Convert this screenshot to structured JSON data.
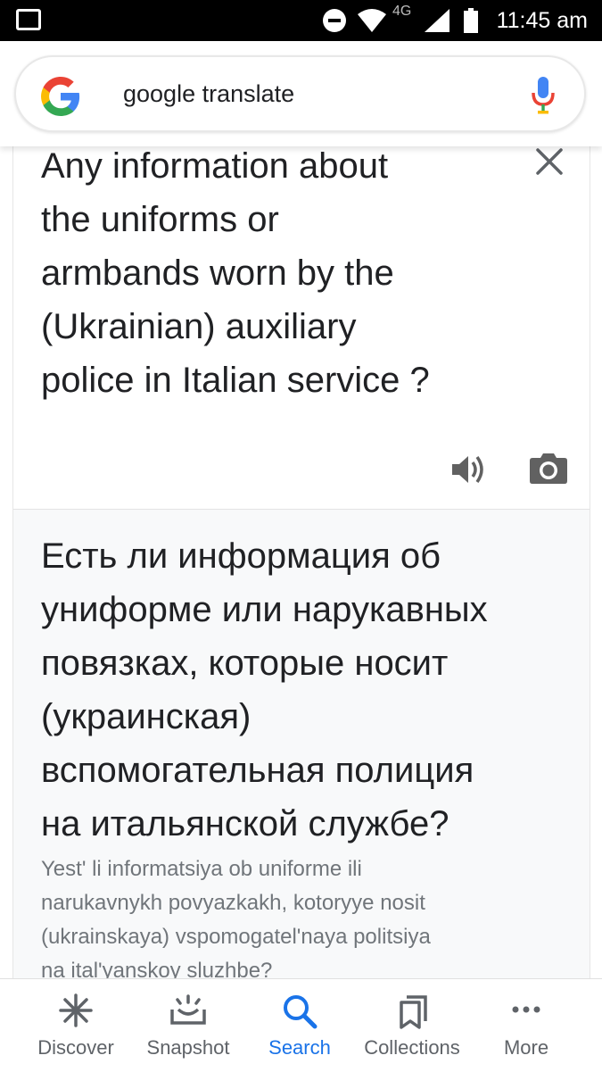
{
  "status_bar": {
    "time": "11:45 am",
    "network": "4G"
  },
  "search": {
    "query": "google translate",
    "logo_icon": "google-g-icon",
    "mic_icon": "mic-icon"
  },
  "translate": {
    "source_text": "Any information about\nthe uniforms or\narmbands worn by the\n(Ukrainian) auxiliary\npolice in Italian service ?",
    "target_text": "Есть ли информация об\nуниформе или нарукавных\nповязках, которые носит\n(украинская)\nвспомогательная полиция\nна итальянской службе?",
    "transliteration": "Yest' li informatsiya ob uniforme ili\nnarukavnykh povyazkakh, kotoryye nosit\n(ukrainskaya) vspomogatel'naya politsiya\nna ital'yanskoy sluzhbe?",
    "icons": [
      "close-icon",
      "speaker-icon",
      "camera-icon"
    ]
  },
  "bottom_nav": {
    "items": [
      {
        "label": "Discover",
        "icon": "asterisk-icon"
      },
      {
        "label": "Snapshot",
        "icon": "snapshot-icon"
      },
      {
        "label": "Search",
        "icon": "search-icon"
      },
      {
        "label": "Collections",
        "icon": "collections-icon"
      },
      {
        "label": "More",
        "icon": "more-dots-icon"
      }
    ],
    "active": "Search"
  },
  "colors": {
    "google_blue": "#4285F4",
    "google_red": "#EA4335",
    "google_yellow": "#FBBC05",
    "google_green": "#34A853",
    "active_nav": "#1a73e8"
  }
}
